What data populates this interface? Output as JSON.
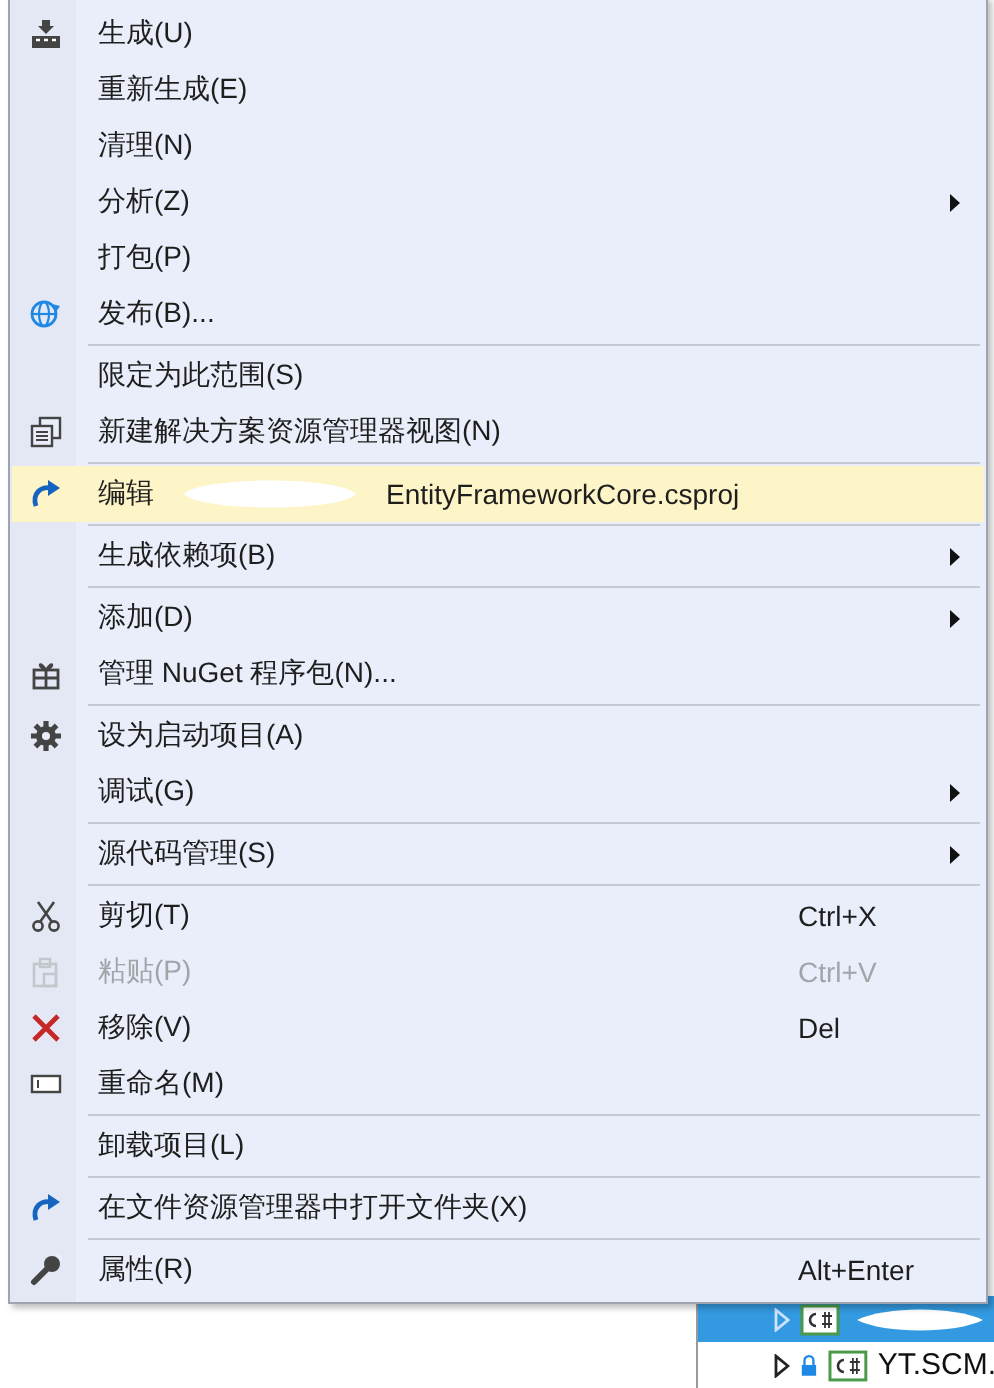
{
  "context_menu": {
    "items": [
      {
        "kind": "item",
        "label": "生成(U)",
        "submenu": false,
        "disabled": false,
        "selected": false
      },
      {
        "kind": "item",
        "label": "重新生成(E)",
        "submenu": false,
        "disabled": false,
        "selected": false
      },
      {
        "kind": "item",
        "label": "清理(N)",
        "submenu": false,
        "disabled": false,
        "selected": false
      },
      {
        "kind": "item",
        "label": "分析(Z)",
        "submenu": true,
        "disabled": false,
        "selected": false
      },
      {
        "kind": "item",
        "label": "打包(P)",
        "submenu": false,
        "disabled": false,
        "selected": false
      },
      {
        "kind": "item",
        "label": "发布(B)...",
        "submenu": false,
        "disabled": false,
        "selected": false
      },
      {
        "kind": "separator"
      },
      {
        "kind": "item",
        "label": "限定为此范围(S)",
        "submenu": false,
        "disabled": false,
        "selected": false
      },
      {
        "kind": "item",
        "label": "新建解决方案资源管理器视图(N)",
        "submenu": false,
        "disabled": false,
        "selected": false
      },
      {
        "kind": "separator"
      },
      {
        "kind": "item",
        "label": "编辑",
        "label_2": "EntityFrameworkCore.csproj",
        "redacted": true,
        "submenu": false,
        "disabled": false,
        "selected": true
      },
      {
        "kind": "separator"
      },
      {
        "kind": "item",
        "label": "生成依赖项(B)",
        "submenu": true,
        "disabled": false,
        "selected": false
      },
      {
        "kind": "separator"
      },
      {
        "kind": "item",
        "label": "添加(D)",
        "submenu": true,
        "disabled": false,
        "selected": false
      },
      {
        "kind": "item",
        "label": "管理 NuGet 程序包(N)...",
        "submenu": false,
        "disabled": false,
        "selected": false
      },
      {
        "kind": "separator"
      },
      {
        "kind": "item",
        "label": "设为启动项目(A)",
        "submenu": false,
        "disabled": false,
        "selected": false
      },
      {
        "kind": "item",
        "label": "调试(G)",
        "submenu": true,
        "disabled": false,
        "selected": false
      },
      {
        "kind": "separator"
      },
      {
        "kind": "item",
        "label": "源代码管理(S)",
        "submenu": true,
        "disabled": false,
        "selected": false
      },
      {
        "kind": "separator"
      },
      {
        "kind": "item",
        "label": "剪切(T)",
        "shortcut": "Ctrl+X",
        "submenu": false,
        "disabled": false,
        "selected": false
      },
      {
        "kind": "item",
        "label": "粘贴(P)",
        "shortcut": "Ctrl+V",
        "submenu": false,
        "disabled": true,
        "selected": false
      },
      {
        "kind": "item",
        "label": "移除(V)",
        "shortcut": "Del",
        "submenu": false,
        "disabled": false,
        "selected": false
      },
      {
        "kind": "item",
        "label": "重命名(M)",
        "submenu": false,
        "disabled": false,
        "selected": false
      },
      {
        "kind": "separator"
      },
      {
        "kind": "item",
        "label": "卸载项目(L)",
        "submenu": false,
        "disabled": false,
        "selected": false
      },
      {
        "kind": "separator"
      },
      {
        "kind": "item",
        "label": "在文件资源管理器中打开文件夹(X)",
        "submenu": false,
        "disabled": false,
        "selected": false
      },
      {
        "kind": "separator"
      },
      {
        "kind": "item",
        "label": "属性(R)",
        "shortcut": "Alt+Enter",
        "submenu": false,
        "disabled": false,
        "selected": false
      }
    ]
  },
  "solution_explorer": {
    "rows": [
      {
        "selected": true,
        "redacted": true
      },
      {
        "selected": false,
        "locked": true,
        "label": "YT.SCM."
      }
    ]
  }
}
